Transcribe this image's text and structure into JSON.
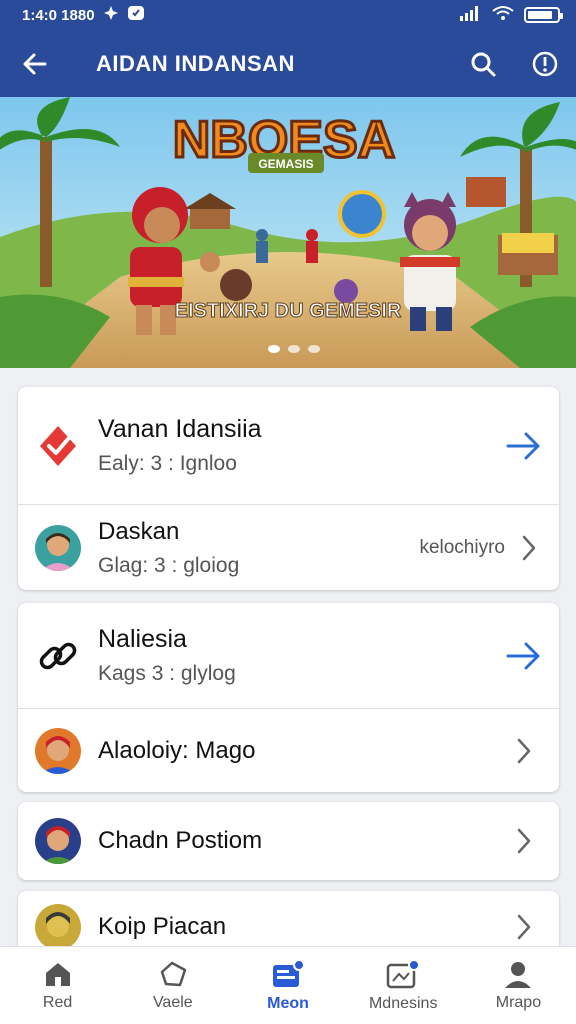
{
  "status_bar": {
    "time": "1:4:0 1880",
    "battery_level": 0.85
  },
  "app_bar": {
    "title": "AIDAN INDANSAN"
  },
  "hero": {
    "logo_text": "NBOESA",
    "logo_sub": "GEMASIS",
    "caption": "EISTIXIRJ DU GEMESIR"
  },
  "cards": [
    {
      "rows": [
        {
          "title": "Vanan Idansiia",
          "subtitle": "Ealy: 3 : Ignloo",
          "icon": "check-shield-icon",
          "trail": "arrow-right-icon"
        },
        {
          "title": "Daskan",
          "subtitle": "Glag: 3 : gloiog",
          "icon": "avatar",
          "trail_text": "kelochiyro",
          "trail": "chevron-right-icon"
        }
      ]
    },
    {
      "rows": [
        {
          "title": "Naliesia",
          "subtitle": "Kags 3 : glylog",
          "icon": "link-icon",
          "trail": "arrow-right-icon"
        },
        {
          "title": "Alaoloiy: Mago",
          "icon": "avatar",
          "trail": "chevron-right-icon"
        }
      ]
    },
    {
      "rows": [
        {
          "title": "Chadn Postiom",
          "icon": "avatar",
          "trail": "chevron-right-icon"
        }
      ]
    },
    {
      "rows": [
        {
          "title": "Koip Piacan",
          "icon": "avatar",
          "trail": "chevron-right-icon"
        }
      ]
    }
  ],
  "bottom_nav": [
    {
      "label": "Red",
      "icon": "home-icon",
      "active": false
    },
    {
      "label": "Vaele",
      "icon": "tag-icon",
      "active": false
    },
    {
      "label": "Meon",
      "icon": "news-icon",
      "active": true
    },
    {
      "label": "Mdnesins",
      "icon": "media-icon",
      "active": false
    },
    {
      "label": "Mrapo",
      "icon": "profile-icon",
      "active": false
    }
  ],
  "colors": {
    "primary": "#2a4a9a",
    "accent": "#2a5bd7",
    "danger": "#e53935"
  }
}
